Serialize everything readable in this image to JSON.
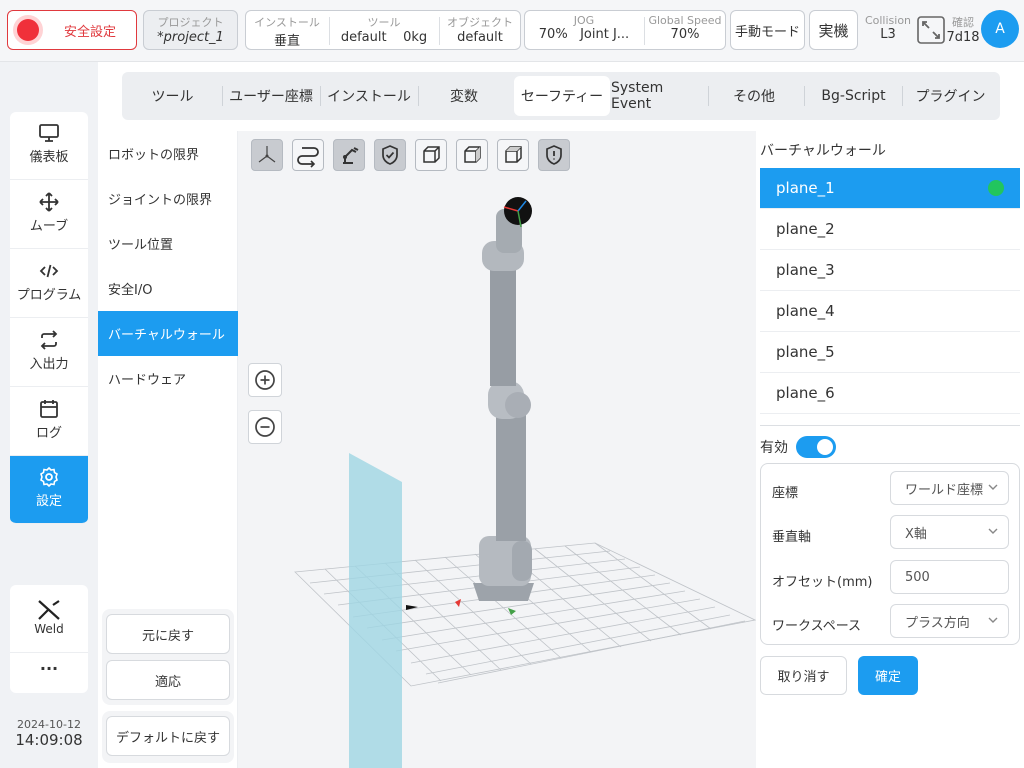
{
  "topbar": {
    "safety_label": "安全設定",
    "project_label": "プロジェクト",
    "project_value": "*project_1",
    "install_label": "インストール",
    "install_value": "垂直",
    "tool_label": "ツール",
    "tool_value": "default",
    "tool_mass": "0kg",
    "object_label": "オブジェクト",
    "object_value": "default",
    "jog_label": "JOG",
    "jog_value": "70%",
    "jog_mode": "Joint J...",
    "speed_label": "Global Speed",
    "speed_value": "70%",
    "manual_mode": "手動モード",
    "real_machine": "実機",
    "collision_label": "Collision",
    "collision_value": "L3",
    "confirm_label": "確認",
    "confirm_value": "7d18",
    "avatar_letter": "A"
  },
  "nav": {
    "items": [
      {
        "label": "儀表板",
        "icon": "monitor-icon"
      },
      {
        "label": "ムーブ",
        "icon": "move-icon"
      },
      {
        "label": "プログラム",
        "icon": "code-icon"
      },
      {
        "label": "入出力",
        "icon": "io-arrows-icon"
      },
      {
        "label": "ログ",
        "icon": "calendar-icon"
      },
      {
        "label": "設定",
        "icon": "gear-icon"
      }
    ],
    "weld_label": "Weld",
    "more_label": "···",
    "date": "2024-10-12",
    "time": "14:09:08"
  },
  "tabs": [
    "ツール",
    "ユーザー座標",
    "インストール",
    "変数",
    "セーフティー",
    "System Event",
    "その他",
    "Bg-Script",
    "プラグイン"
  ],
  "active_tab": "セーフティー",
  "submenu": {
    "items": [
      "ロボットの限界",
      "ジョイントの限界",
      "ツール位置",
      "安全I/O",
      "バーチャルウォール",
      "ハードウェア"
    ],
    "active": "バーチャルウォール",
    "revert_label": "元に戻す",
    "apply_label": "適応",
    "default_label": "デフォルトに戻す"
  },
  "viewport": {
    "toolbar_icons": [
      "axis-view-icon",
      "path-icon",
      "robot-icon",
      "shield-check-icon",
      "cube-front-icon",
      "cube-side-icon",
      "cube-top-icon",
      "shield-alert-icon"
    ],
    "zoom_in_icon": "zoom-in-icon",
    "zoom_out_icon": "zoom-out-icon"
  },
  "virtual_wall": {
    "title": "バーチャルウォール",
    "planes": [
      "plane_1",
      "plane_2",
      "plane_3",
      "plane_4",
      "plane_5",
      "plane_6"
    ],
    "active_plane": "plane_1",
    "enabled_label": "有効",
    "enabled": true,
    "coord_label": "座標",
    "coord_value": "ワールド座標",
    "axis_label": "垂直軸",
    "axis_value": "X軸",
    "offset_label": "オフセット(mm)",
    "offset_value": "500",
    "workspace_label": "ワークスペース",
    "workspace_value": "プラス方向",
    "cancel_label": "取り消す",
    "confirm_label": "確定"
  },
  "colors": {
    "accent": "#1c9cf0",
    "danger": "#e0393e",
    "status_green": "#22c55e"
  }
}
